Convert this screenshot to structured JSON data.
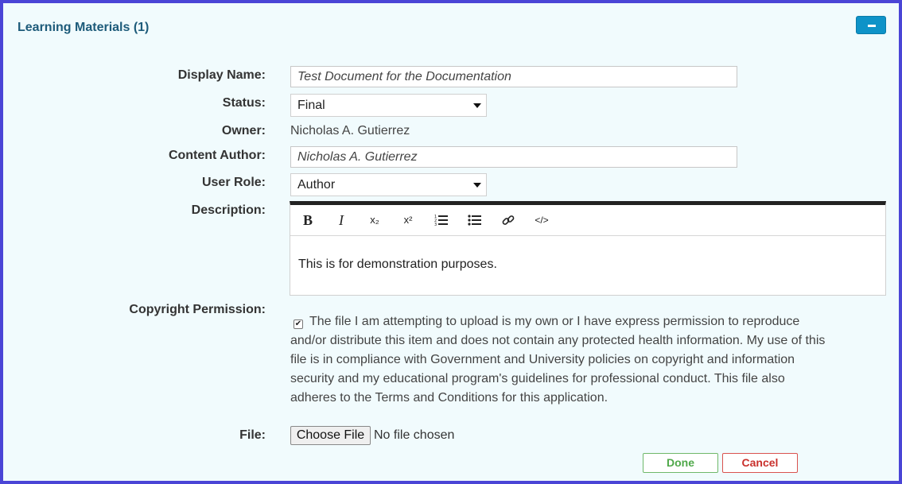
{
  "panel": {
    "title": "Learning Materials (1)",
    "collapse_icon": "minus-icon"
  },
  "form": {
    "display_name": {
      "label": "Display Name:",
      "value": "Test Document for the Documentation"
    },
    "status": {
      "label": "Status:",
      "value": "Final"
    },
    "owner": {
      "label": "Owner:",
      "value": "Nicholas A. Gutierrez"
    },
    "content_author": {
      "label": "Content Author:",
      "value": "Nicholas A. Gutierrez"
    },
    "user_role": {
      "label": "User Role:",
      "value": "Author"
    },
    "description": {
      "label": "Description:",
      "toolbar": {
        "bold": "B",
        "italic": "I",
        "subscript": "x₂",
        "superscript": "x²",
        "ordered_list": "ordered-list-icon",
        "unordered_list": "unordered-list-icon",
        "link": "link-icon",
        "code": "</>"
      },
      "value": "This is for demonstration purposes."
    },
    "copyright": {
      "label": "Copyright Permission:",
      "checked": true,
      "text": "The file I am attempting to upload is my own or I have express permission to reproduce and/or distribute this item and does not contain any protected health information. My use of this file is in compliance with Government and University policies on copyright and information security and my educational program's guidelines for professional conduct. This file also adheres to the Terms and Conditions for this application."
    },
    "file": {
      "label": "File:",
      "button": "Choose File",
      "status": "No file chosen"
    }
  },
  "actions": {
    "done": "Done",
    "cancel": "Cancel"
  },
  "colors": {
    "frame": "#4a45d6",
    "panel_bg": "#f1fbfd",
    "title": "#1d5b7a",
    "accent": "#0e93c8",
    "done": "#4fa84a",
    "cancel": "#c9302c"
  }
}
